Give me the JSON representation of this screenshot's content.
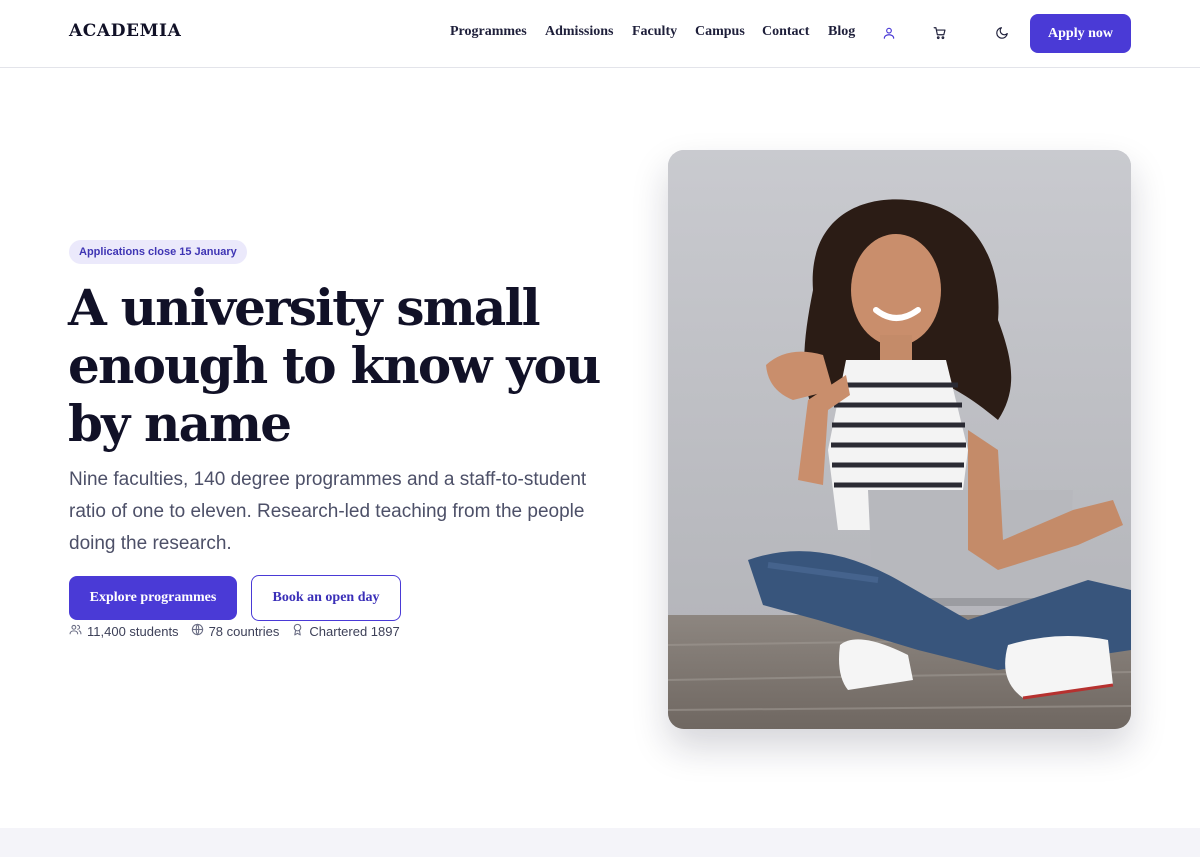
{
  "brand": {
    "logo_text": "ACADEMIA",
    "accent": "#4a3ad6"
  },
  "nav": {
    "items": [
      {
        "label": "Programmes"
      },
      {
        "label": "Admissions"
      },
      {
        "label": "Faculty"
      },
      {
        "label": "Campus"
      },
      {
        "label": "Contact"
      },
      {
        "label": "Blog"
      }
    ],
    "icons": [
      "user-icon",
      "cart-icon",
      "moon-icon"
    ],
    "apply_label": "Apply now"
  },
  "hero": {
    "badge": "Applications close 15 January",
    "headline": "A university small enough to know you by name",
    "lede": "Nine faculties, 140 degree programmes and a staff-to-student ratio of one to eleven. Research-led teaching from the people doing the research.",
    "primary_cta": "Explore programmes",
    "secondary_cta": "Book an open day",
    "stats": [
      {
        "icon": "users-icon",
        "text": "11,400 students"
      },
      {
        "icon": "globe-icon",
        "text": "78 countries"
      },
      {
        "icon": "award-icon",
        "text": "Chartered 1897"
      }
    ],
    "image_icon": "student-with-laptop-photo"
  }
}
